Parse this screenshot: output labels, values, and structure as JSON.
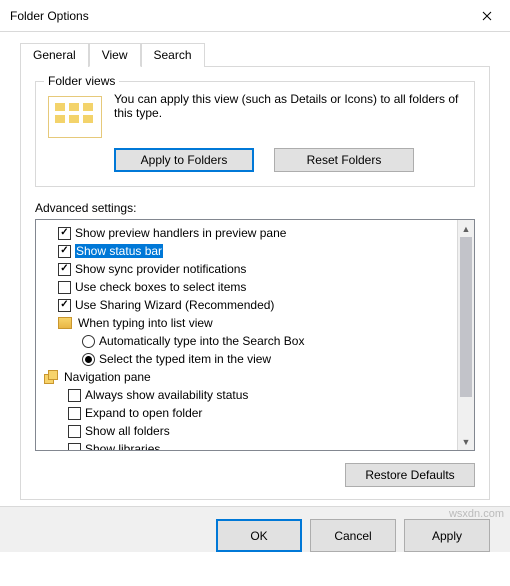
{
  "window": {
    "title": "Folder Options"
  },
  "tabs": {
    "general": "General",
    "view": "View",
    "search": "Search"
  },
  "folderViews": {
    "groupTitle": "Folder views",
    "description": "You can apply this view (such as Details or Icons) to all folders of this type.",
    "applyBtn": "Apply to Folders",
    "resetBtn": "Reset Folders"
  },
  "advanced": {
    "label": "Advanced settings:",
    "items": {
      "showPreview": "Show preview handlers in preview pane",
      "showStatus": "Show status bar",
      "showSync": "Show sync provider notifications",
      "useCheck": "Use check boxes to select items",
      "useSharing": "Use Sharing Wizard (Recommended)",
      "typingGroup": "When typing into list view",
      "autoType": "Automatically type into the Search Box",
      "selectTyped": "Select the typed item in the view",
      "navPane": "Navigation pane",
      "alwaysAvail": "Always show availability status",
      "expandOpen": "Expand to open folder",
      "showAllFolders": "Show all folders",
      "showLibraries": "Show libraries"
    },
    "restoreBtn": "Restore Defaults"
  },
  "footer": {
    "ok": "OK",
    "cancel": "Cancel",
    "apply": "Apply"
  },
  "watermark": "wsxdn.com"
}
